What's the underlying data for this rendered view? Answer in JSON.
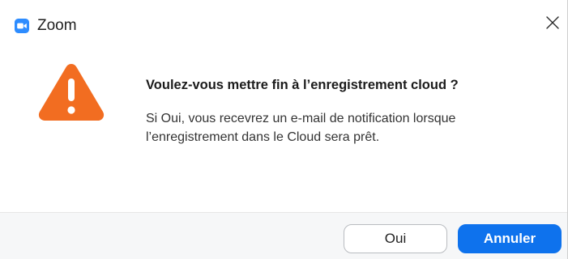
{
  "window": {
    "title": "Zoom",
    "app_icon": "zoom-camera-icon",
    "close_icon": "close-icon"
  },
  "dialog": {
    "headline": "Voulez-vous mettre fin à l’enregistrement cloud ?",
    "body_line1": "Si Oui, vous recevrez un e-mail de notification lorsque",
    "body_line2": "l’enregistrement dans le Cloud sera prêt.",
    "icon": "warning-icon"
  },
  "buttons": {
    "yes_label": "Oui",
    "cancel_label": "Annuler"
  },
  "colors": {
    "accent": "#0e72ed",
    "warning": "#f26d21",
    "footer_bg": "#f6f7f8"
  }
}
